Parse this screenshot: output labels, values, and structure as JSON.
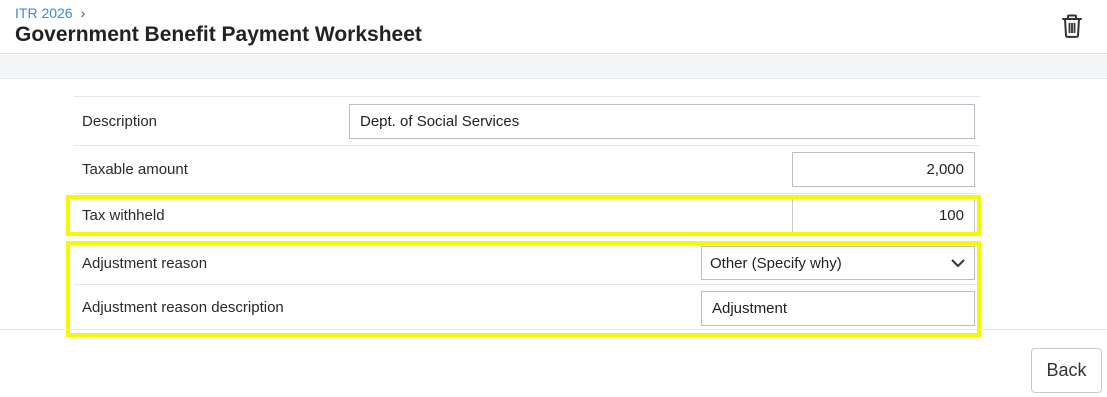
{
  "header": {
    "breadcrumb": "ITR 2026",
    "breadcrumb_sep": "›",
    "title": "Government Benefit Payment Worksheet",
    "delete_icon": "trash-icon"
  },
  "form": {
    "description": {
      "label": "Description",
      "value": "Dept. of Social Services"
    },
    "taxable_amount": {
      "label": "Taxable amount",
      "value": "2,000"
    },
    "tax_withheld": {
      "label": "Tax withheld",
      "value": "100"
    },
    "adjustment_reason": {
      "label": "Adjustment reason",
      "value": "Other (Specify why)"
    },
    "adjustment_reason_description": {
      "label": "Adjustment reason description",
      "value": "Adjustment"
    }
  },
  "footer": {
    "back_label": "Back"
  },
  "colors": {
    "highlight": "#f7f700",
    "link": "#3a8bd6"
  }
}
